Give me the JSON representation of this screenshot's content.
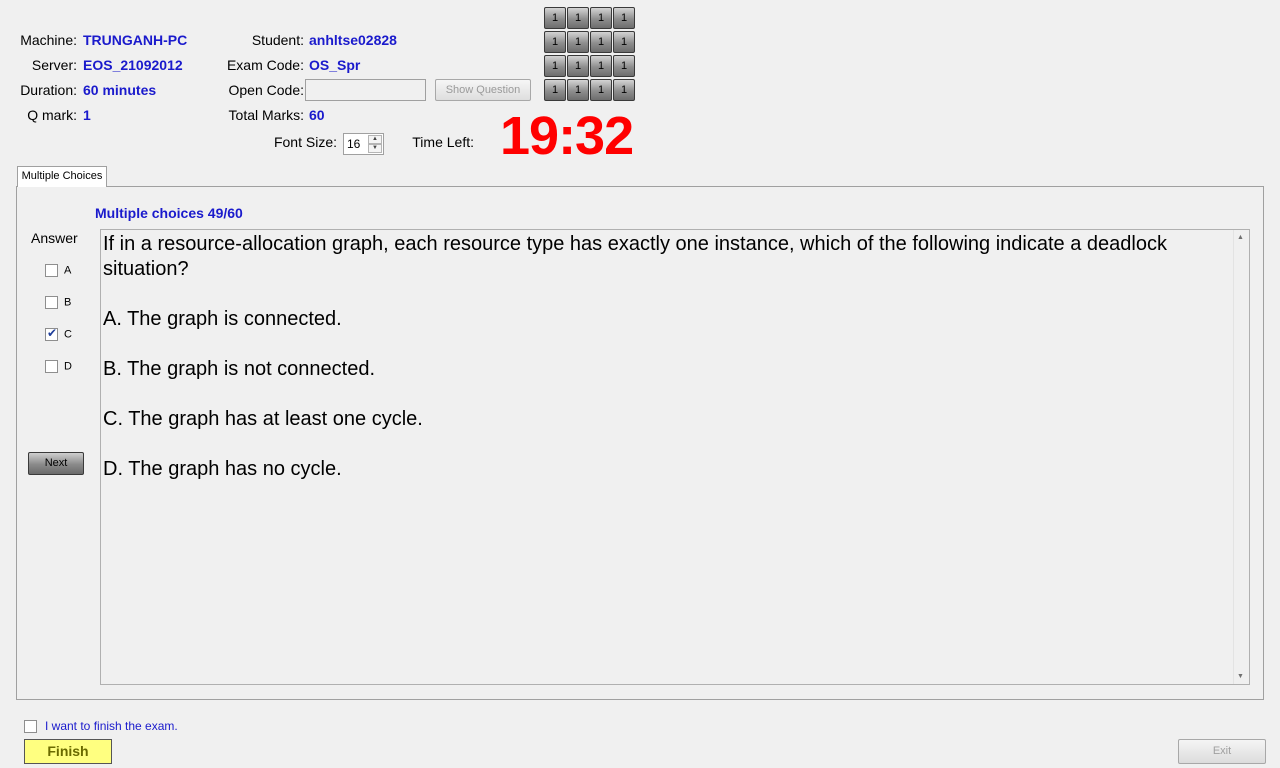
{
  "info": {
    "machine_label": "Machine:",
    "machine_value": "TRUNGANH-PC",
    "server_label": "Server:",
    "server_value": "EOS_21092012",
    "duration_label": "Duration:",
    "duration_value": "60 minutes",
    "qmark_label": "Q mark:",
    "qmark_value": "1",
    "student_label": "Student:",
    "student_value": "anhltse02828",
    "examcode_label": "Exam Code:",
    "examcode_value": "OS_Spr",
    "opencode_label": "Open Code:",
    "opencode_value": "",
    "totalmarks_label": "Total Marks:",
    "totalmarks_value": "60"
  },
  "controls": {
    "show_question_label": "Show Question",
    "fontsize_label": "Font Size:",
    "fontsize_value": "16",
    "timeleft_label": "Time Left:",
    "time_left": "19:32"
  },
  "question_grid": [
    "1",
    "1",
    "1",
    "1",
    "1",
    "1",
    "1",
    "1",
    "1",
    "1",
    "1",
    "1",
    "1",
    "1",
    "1",
    "1"
  ],
  "tabs": [
    {
      "label": "Multiple Choices",
      "active": true
    }
  ],
  "question": {
    "header": "Multiple choices 49/60",
    "text": "If in a resource-allocation graph, each resource type has exactly one instance, which of the following indicate a deadlock situation?",
    "options": [
      "A.  The graph is connected.",
      "B.  The graph is not connected.",
      "C.  The graph has at least one cycle.",
      "D.  The graph has no cycle."
    ]
  },
  "answers": {
    "title": "Answer",
    "choices": [
      {
        "label": "A",
        "checked": false
      },
      {
        "label": "B",
        "checked": false
      },
      {
        "label": "C",
        "checked": true
      },
      {
        "label": "D",
        "checked": false
      }
    ],
    "next_label": "Next"
  },
  "footer": {
    "finish_check_label": "I want to finish the exam.",
    "finish_label": "Finish",
    "exit_label": "Exit"
  },
  "colors": {
    "value_blue": "#1a1acc",
    "timer_red": "#ff0000",
    "finish_yellow": "#ffff80"
  }
}
